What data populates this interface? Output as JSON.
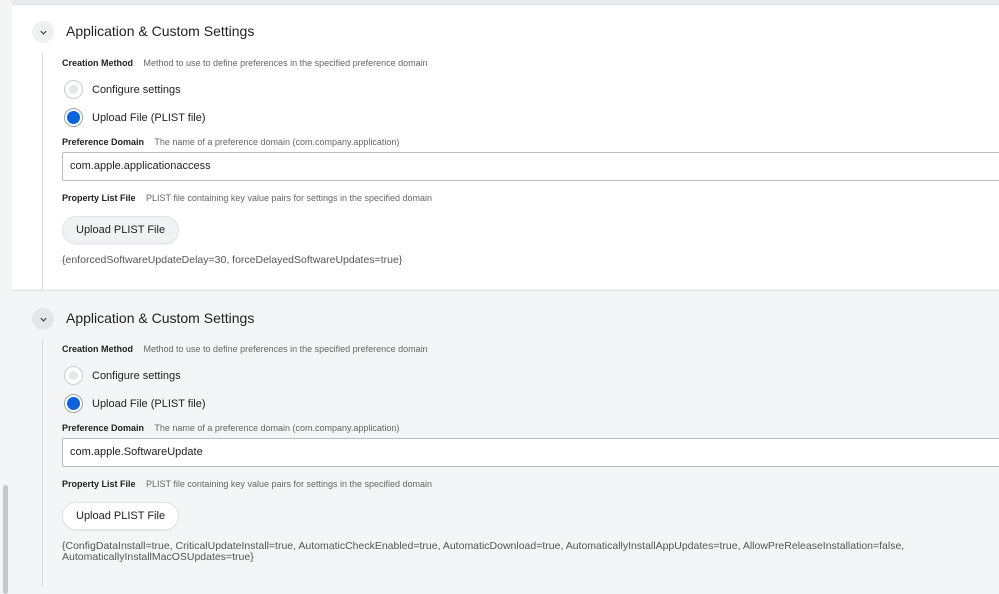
{
  "sections": [
    {
      "title": "Application & Custom Settings",
      "creation_method": {
        "label": "Creation Method",
        "description": "Method to use to define preferences in the specified preference domain",
        "options": [
          {
            "label": "Configure settings",
            "selected": false
          },
          {
            "label": "Upload File (PLIST file)",
            "selected": true
          }
        ]
      },
      "preference_domain": {
        "label": "Preference Domain",
        "description": "The name of a preference domain (com.company.application)",
        "value": "com.apple.applicationaccess"
      },
      "property_list_file": {
        "label": "Property List File",
        "description": "PLIST file containing key value pairs for settings in the specified domain",
        "button_label": "Upload PLIST File",
        "contents": "{enforcedSoftwareUpdateDelay=30, forceDelayedSoftwareUpdates=true}"
      }
    },
    {
      "title": "Application & Custom Settings",
      "creation_method": {
        "label": "Creation Method",
        "description": "Method to use to define preferences in the specified preference domain",
        "options": [
          {
            "label": "Configure settings",
            "selected": false
          },
          {
            "label": "Upload File (PLIST file)",
            "selected": true
          }
        ]
      },
      "preference_domain": {
        "label": "Preference Domain",
        "description": "The name of a preference domain (com.company.application)",
        "value": "com.apple.SoftwareUpdate"
      },
      "property_list_file": {
        "label": "Property List File",
        "description": "PLIST file containing key value pairs for settings in the specified domain",
        "button_label": "Upload PLIST File",
        "contents": "{ConfigDataInstall=true, CriticalUpdateInstall=true, AutomaticCheckEnabled=true, AutomaticDownload=true, AutomaticallyInstallAppUpdates=true, AllowPreReleaseInstallation=false, AutomaticallyInstallMacOSUpdates=true}"
      }
    }
  ],
  "colors": {
    "accent": "#0b63d9",
    "section_bg_1": "#ffffff",
    "section_bg_2": "#f4f5f7"
  },
  "icons": {
    "collapse": "chevron-down-icon"
  }
}
